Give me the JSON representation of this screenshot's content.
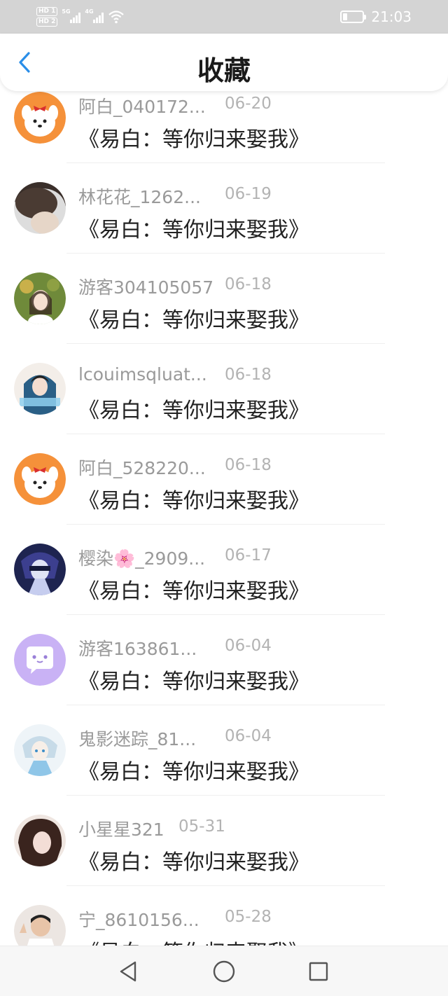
{
  "status_bar": {
    "sim1": "HD 1",
    "sim2": "HD 2",
    "net1": "5G",
    "net2": "4G",
    "time": "21:03"
  },
  "header": {
    "title": "收藏",
    "back_icon": "chevron-left-icon"
  },
  "items": [
    {
      "name": "阿白_040172...",
      "date": "06-20",
      "book": "《易白：等你归来娶我》",
      "avatar": "orange-dog"
    },
    {
      "name": "林花花_1262...",
      "date": "06-19",
      "book": "《易白：等你归来娶我》",
      "avatar": "dark-hair"
    },
    {
      "name": "游客304105057",
      "date": "06-18",
      "book": "《易白：等你归来娶我》",
      "avatar": "green-girl"
    },
    {
      "name": "lcouimsqluat...",
      "date": "06-18",
      "book": "《易白：等你归来娶我》",
      "avatar": "blue-girl"
    },
    {
      "name": "阿白_528220...",
      "date": "06-18",
      "book": "《易白：等你归来娶我》",
      "avatar": "orange-dog"
    },
    {
      "name": "樱染🌸_2909...",
      "date": "06-17",
      "book": "《易白：等你归来娶我》",
      "avatar": "anime-boy"
    },
    {
      "name": "游客163861...",
      "date": "06-04",
      "book": "《易白：等你归来娶我》",
      "avatar": "purple-chat"
    },
    {
      "name": "鬼影迷踪_81...",
      "date": "06-04",
      "book": "《易白：等你归来娶我》",
      "avatar": "anime-light"
    },
    {
      "name": "小星星321",
      "date": "05-31",
      "book": "《易白：等你归来娶我》",
      "avatar": "brown-girl"
    },
    {
      "name": "宁_8610156...",
      "date": "05-28",
      "book": "《易白：等你归来娶我》",
      "avatar": "child"
    }
  ],
  "nav": {
    "back_icon": "triangle-back-icon",
    "home_icon": "circle-home-icon",
    "recent_icon": "square-recent-icon"
  },
  "colors": {
    "accent": "#2a8ee8",
    "status_bar": "#d4d4d4"
  }
}
